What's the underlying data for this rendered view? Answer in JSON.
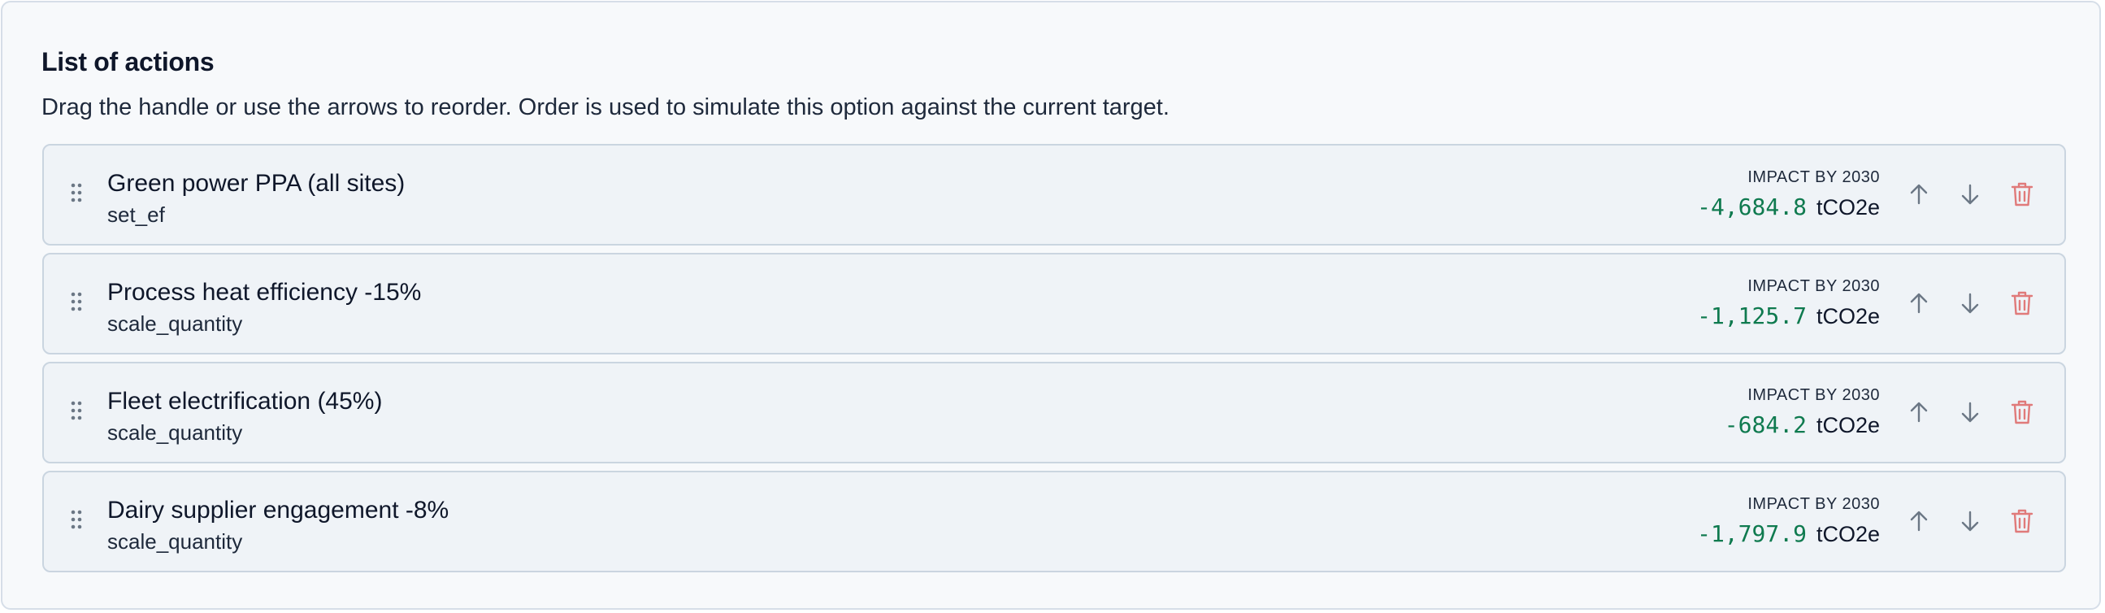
{
  "header": {
    "title": "List of actions",
    "description": "Drag the handle or use the arrows to reorder. Order is used to simulate this option against the current target."
  },
  "actions": [
    {
      "name": "Green power PPA (all sites)",
      "type": "set_ef",
      "impact_label": "IMPACT BY 2030",
      "impact_value": "-4,684.8",
      "impact_unit": "tCO2e"
    },
    {
      "name": "Process heat efficiency -15%",
      "type": "scale_quantity",
      "impact_label": "IMPACT BY 2030",
      "impact_value": "-1,125.7",
      "impact_unit": "tCO2e"
    },
    {
      "name": "Fleet electrification (45%)",
      "type": "scale_quantity",
      "impact_label": "IMPACT BY 2030",
      "impact_value": "-684.2",
      "impact_unit": "tCO2e"
    },
    {
      "name": "Dairy supplier engagement -8%",
      "type": "scale_quantity",
      "impact_label": "IMPACT BY 2030",
      "impact_value": "-1,797.9",
      "impact_unit": "tCO2e"
    }
  ],
  "icons": {
    "handle": "drag-handle-icon",
    "up": "arrow-up-icon",
    "down": "arrow-down-icon",
    "delete": "trash-icon"
  },
  "colors": {
    "impact_value": "#0f7a4f",
    "delete_icon": "#e07a7a",
    "arrow_icon": "#6b7785"
  }
}
